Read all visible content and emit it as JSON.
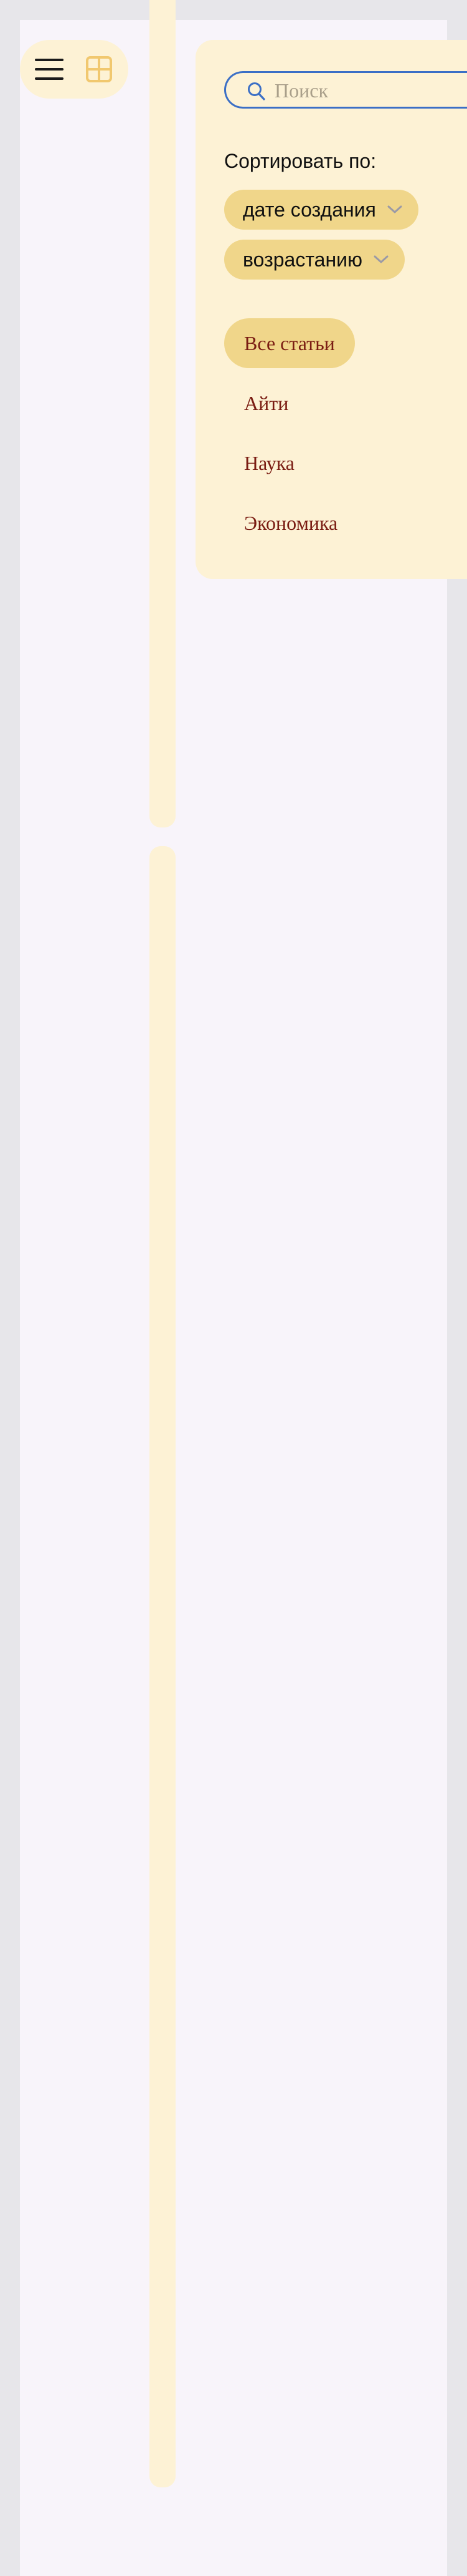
{
  "toolbar": {
    "menu_icon": "hamburger-menu-icon",
    "grid_icon": "grid-view-icon",
    "grid_icon_color": "#f1c86f"
  },
  "filters": {
    "search": {
      "placeholder": "Поиск",
      "value": "",
      "icon": "search-icon",
      "border_color": "#3b6fc6"
    },
    "sort_label": "Сортировать по:",
    "sort_field": "дате создания",
    "sort_order": "возрастанию",
    "categories": [
      {
        "label": "Все статьи",
        "active": true
      },
      {
        "label": "Айти",
        "active": false
      },
      {
        "label": "Наука",
        "active": false
      },
      {
        "label": "Экономика",
        "active": false
      }
    ]
  },
  "colors": {
    "panel_bg": "#fdf2d5",
    "pill_bg": "#f0d68a",
    "category_text": "#7a1c12",
    "page_bg": "#f8f4fa"
  }
}
